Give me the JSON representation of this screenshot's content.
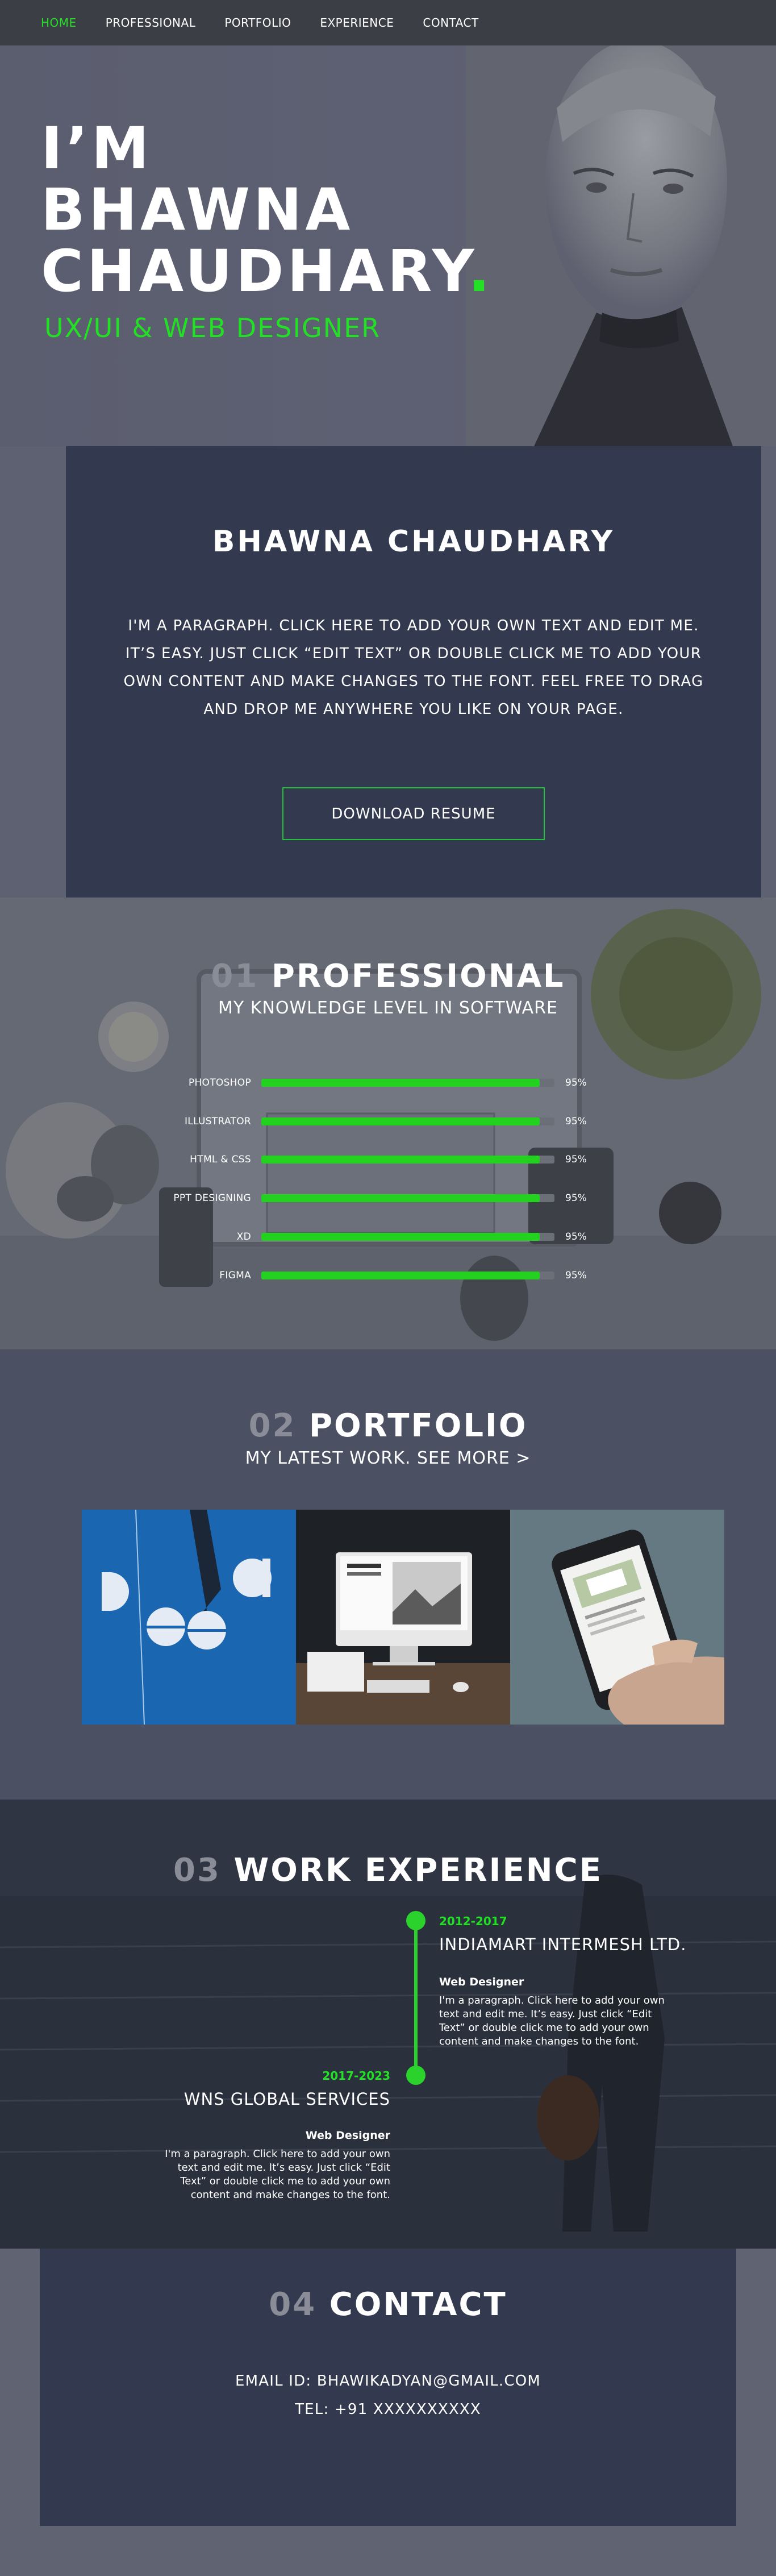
{
  "nav": {
    "items": [
      {
        "label": "HOME",
        "active": true
      },
      {
        "label": "PROFESSIONAL"
      },
      {
        "label": "PORTFOLIO"
      },
      {
        "label": "EXPERIENCE"
      },
      {
        "label": "CONTACT"
      }
    ]
  },
  "hero": {
    "line1": "I’M",
    "line2": "BHAWNA",
    "line3": "CHAUDHARY",
    "dot": ".",
    "subtitle": "UX/UI & WEB DESIGNER"
  },
  "about": {
    "name": "BHAWNA CHAUDHARY",
    "paragraph": "I'M A PARAGRAPH. CLICK HERE TO ADD YOUR OWN TEXT AND EDIT ME. IT’S EASY. JUST CLICK “EDIT TEXT” OR DOUBLE CLICK ME TO ADD YOUR OWN CONTENT AND MAKE CHANGES TO THE FONT. FEEL FREE TO DRAG AND DROP ME ANYWHERE YOU LIKE ON YOUR PAGE.",
    "button": "DOWNLOAD RESUME"
  },
  "professional": {
    "number": "01",
    "title": "PROFESSIONAL",
    "subtitle": "MY KNOWLEDGE LEVEL IN SOFTWARE",
    "skills": [
      {
        "name": "PHOTOSHOP",
        "level": 95,
        "label": "95%"
      },
      {
        "name": "ILLUSTRATOR",
        "level": 95,
        "label": "95%"
      },
      {
        "name": "HTML & CSS",
        "level": 95,
        "label": "95%"
      },
      {
        "name": "PPT DESIGNING",
        "level": 95,
        "label": "95%"
      },
      {
        "name": "XD",
        "level": 95,
        "label": "95%"
      },
      {
        "name": "FIGMA",
        "level": 95,
        "label": "95%"
      }
    ]
  },
  "portfolio": {
    "number": "02",
    "title": "PORTFOLIO",
    "subtitle": "MY LATEST WORK. SEE MORE >"
  },
  "experience": {
    "number": "03",
    "title": "WORK EXPERIENCE",
    "jobs": [
      {
        "date": "2012-2017",
        "company": "INDIAMART INTERMESH LTD.",
        "role": "Web Designer",
        "desc_lines": [
          "I'm a paragraph. Click here to add your own",
          "text and edit me. It’s easy. Just click “Edit",
          "Text” or double click me to add your own",
          "content and make changes to the font."
        ]
      },
      {
        "date": "2017-2023",
        "company": "WNS GLOBAL SERVICES",
        "role": "Web Designer",
        "desc_lines": [
          "I'm a paragraph. Click here to add your own",
          "text and edit me. It’s easy. Just click “Edit",
          "Text” or double click me to add your own",
          "content and make changes to the font."
        ]
      }
    ]
  },
  "contact": {
    "number": "04",
    "title": "CONTACT",
    "email": "EMAIL ID: BHAWIKADYAN@GMAIL.COM",
    "phone": "TEL: +91 XXXXXXXXXX"
  },
  "colors": {
    "accent": "#22e023",
    "nav_bg": "#3c3e45",
    "panel": "#333a50",
    "portfolio_bg": "#4c5063"
  }
}
